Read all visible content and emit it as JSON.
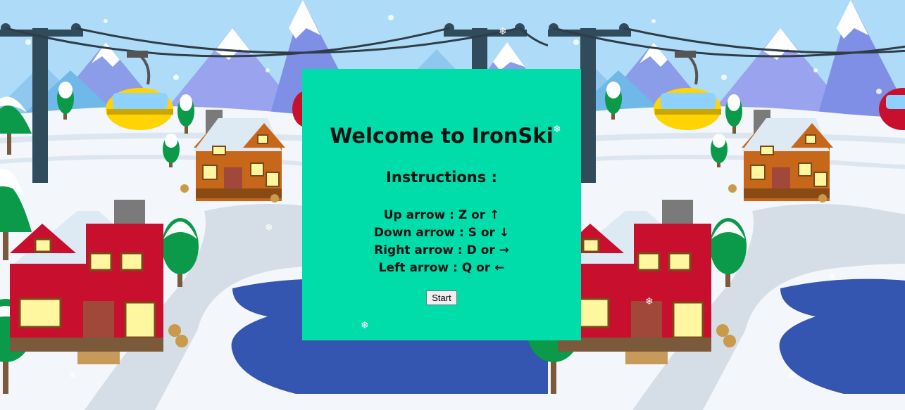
{
  "modal": {
    "title": "Welcome to IronSki",
    "subtitle": "Instructions :",
    "instructions": [
      "Up arrow : Z or ↑",
      "Down arrow : S or ↓",
      "Right arrow : D or →",
      "Left arrow : Q or ←"
    ],
    "start_label": "Start"
  },
  "snowflake_glyph": "❄",
  "colors": {
    "sky": "#aedcf8",
    "modal_bg": "#00dcaa",
    "snow": "#eaf0f6",
    "water": "#3556b0",
    "house_red": "#c8102e",
    "house_orange": "#c7671a",
    "gondola_yellow": "#ffd400",
    "gondola_red": "#c8102e",
    "tree_green": "#0a9a4a",
    "pole": "#2f4b5c"
  }
}
